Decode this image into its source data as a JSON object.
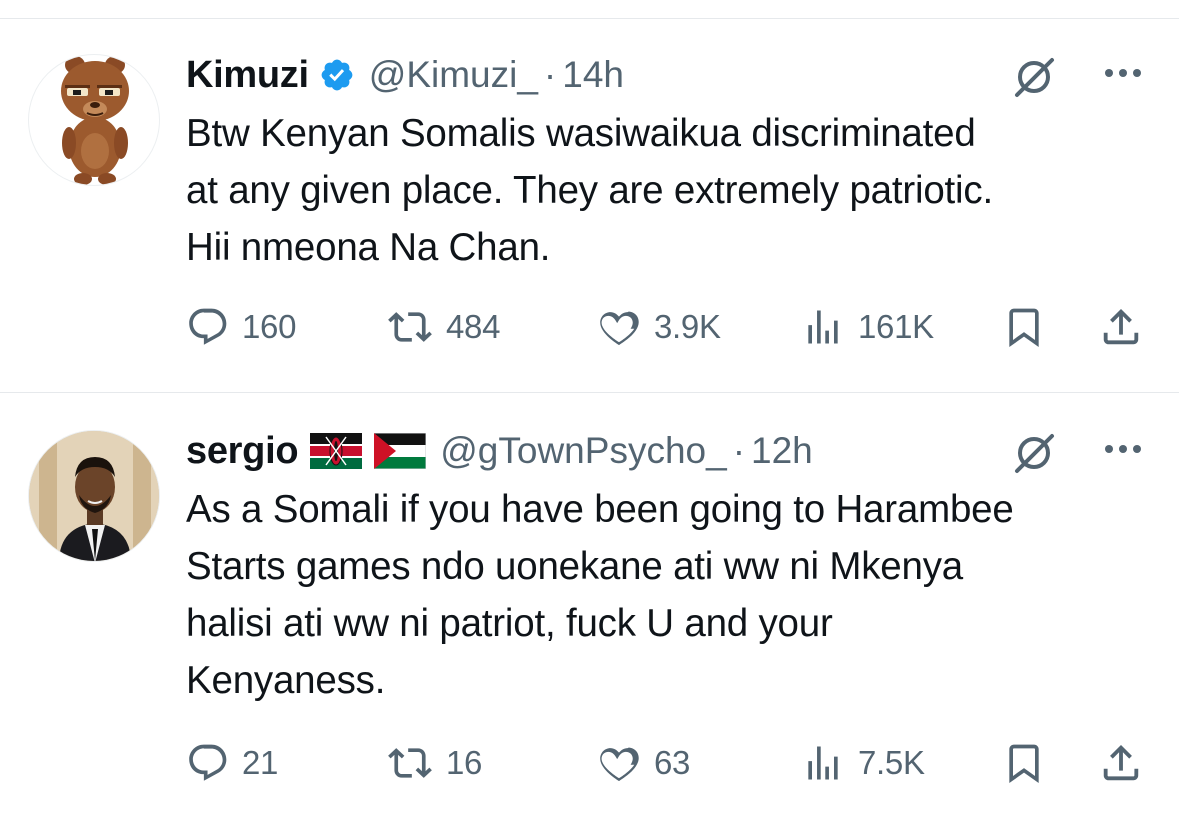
{
  "colors": {
    "text": "#0f1419",
    "secondary": "#536471",
    "verified": "#1d9bf0",
    "divider": "#e6e9ec"
  },
  "tweets": [
    {
      "name": "Kimuzi",
      "verified": true,
      "handle": "@Kimuzi_",
      "separator": "·",
      "time": "14h",
      "text": "Btw Kenyan Somalis wasiwaikua discriminated\nat any given place. They are extremely patriotic.\nHii nmeona Na Chan.",
      "replies": "160",
      "reposts": "484",
      "likes": "3.9K",
      "views": "161K",
      "icons": [
        "grok-icon",
        "more-icon",
        "reply-icon",
        "repost-icon",
        "like-icon",
        "views-icon",
        "bookmark-icon",
        "share-icon"
      ]
    },
    {
      "name": "sergio",
      "flags": [
        "kenya-flag",
        "palestine-flag"
      ],
      "handle": "@gTownPsycho_",
      "separator": "·",
      "time": "12h",
      "text": "As a Somali if you have been going to Harambee\nStarts games ndo uonekane ati ww ni Mkenya\nhalisi ati ww ni patriot, fuck U and your\nKenyaness.",
      "replies": "21",
      "reposts": "16",
      "likes": "63",
      "views": "7.5K",
      "icons": [
        "grok-icon",
        "more-icon",
        "reply-icon",
        "repost-icon",
        "like-icon",
        "views-icon",
        "bookmark-icon",
        "share-icon"
      ]
    }
  ]
}
